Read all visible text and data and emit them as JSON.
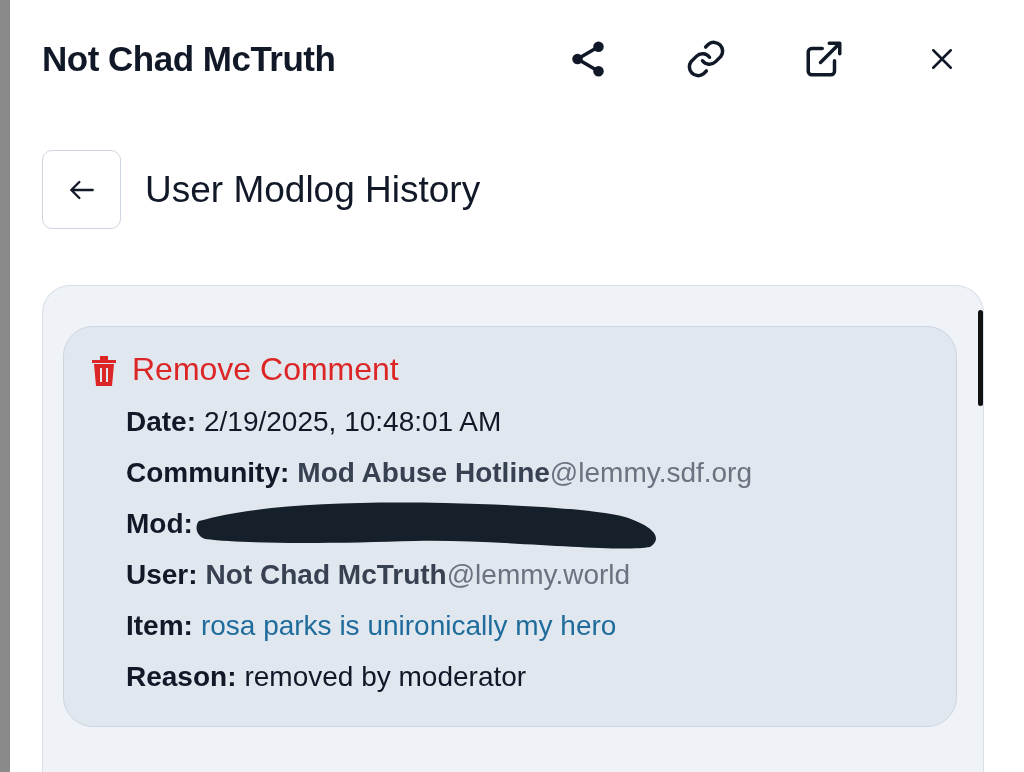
{
  "header": {
    "title": "Not Chad McTruth"
  },
  "page": {
    "title": "User Modlog History"
  },
  "entries": [
    {
      "action": "Remove Comment",
      "fields": [
        {
          "kind": "text",
          "label": "Date:",
          "value": "2/19/2025, 10:48:01 AM"
        },
        {
          "kind": "handle",
          "label": "Community:",
          "value": "Mod Abuse Hotline",
          "instance": "@lemmy.sdf.org"
        },
        {
          "kind": "redacted",
          "label": "Mod:"
        },
        {
          "kind": "handle",
          "label": "User:",
          "value": "Not Chad McTruth",
          "instance": "@lemmy.world"
        },
        {
          "kind": "link",
          "label": "Item:",
          "value": "rosa parks is unironically my hero"
        },
        {
          "kind": "text",
          "label": "Reason:",
          "value": "removed by moderator"
        }
      ]
    }
  ]
}
